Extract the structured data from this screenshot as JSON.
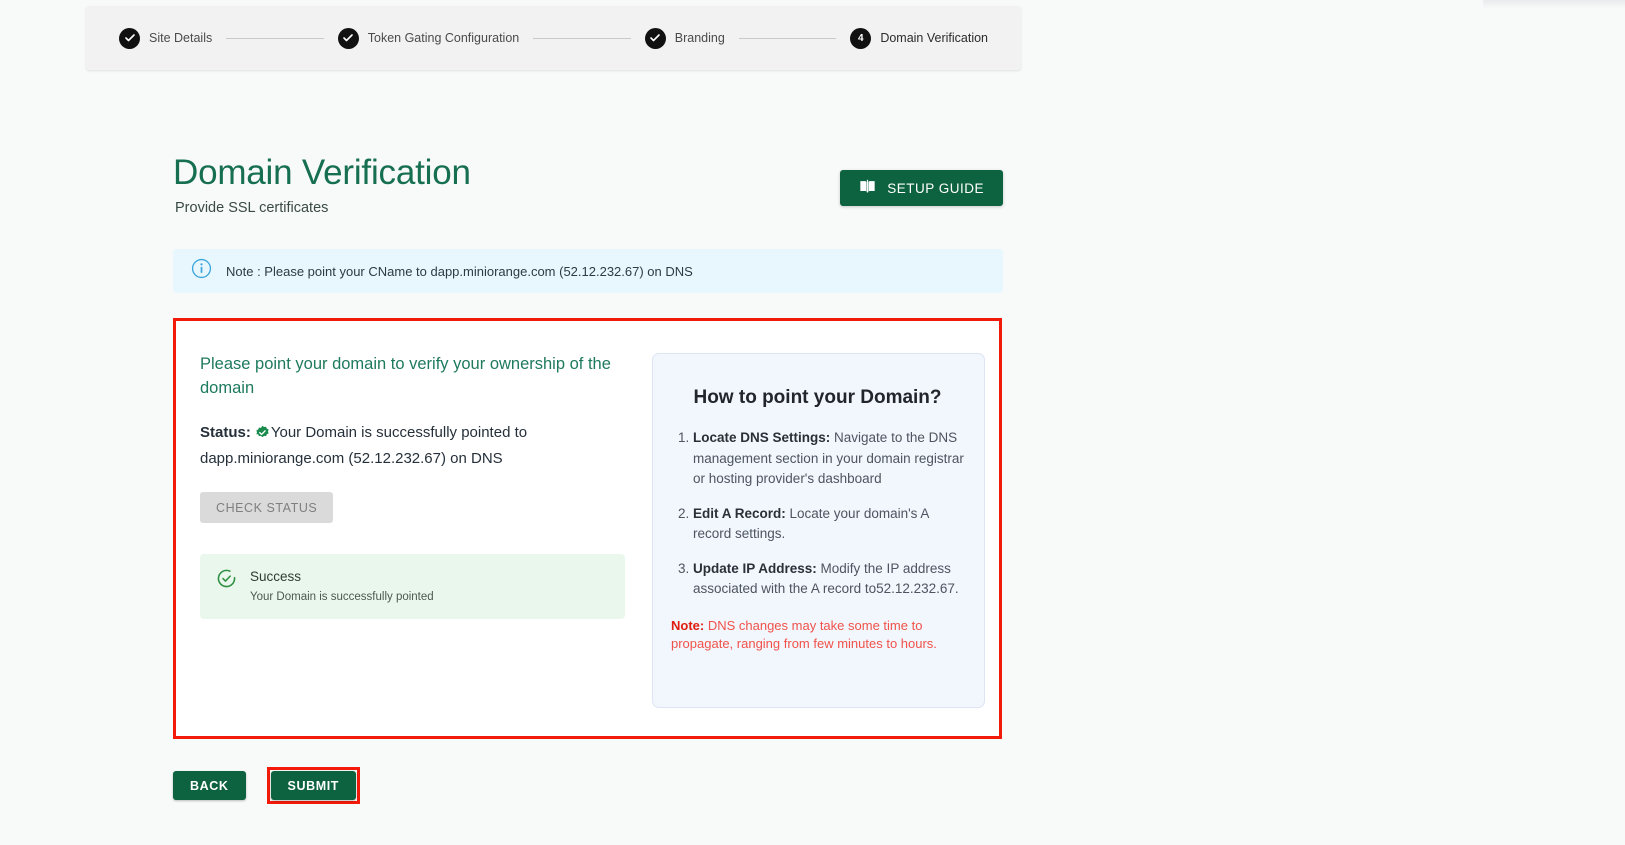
{
  "stepper": {
    "steps": [
      {
        "label": "Site Details",
        "marker": "check",
        "state": "complete"
      },
      {
        "label": "Token Gating Configuration",
        "marker": "check",
        "state": "complete"
      },
      {
        "label": "Branding",
        "marker": "check",
        "state": "complete"
      },
      {
        "label": "Domain Verification",
        "marker": "4",
        "state": "active"
      }
    ]
  },
  "header": {
    "title": "Domain Verification",
    "subtitle": "Provide SSL certificates",
    "setup_guide_label": "SETUP GUIDE"
  },
  "note_bar": {
    "icon": "info-icon",
    "text": "Note : Please point your CName to dapp.miniorange.com (52.12.232.67) on DNS"
  },
  "main": {
    "left": {
      "heading": "Please point your domain to verify your ownership of the domain",
      "status_label": "Status:",
      "status_text": "Your Domain is successfully pointed to dapp.miniorange.com (52.12.232.67) on DNS",
      "status_badge": "verified-badge-icon",
      "check_status_label": "CHECK STATUS",
      "success": {
        "icon": "check-circle-icon",
        "title": "Success",
        "description": "Your Domain is successfully pointed"
      }
    },
    "right": {
      "title": "How to point your Domain?",
      "steps": [
        {
          "term": "Locate DNS Settings:",
          "text": " Navigate to the DNS management section in your domain registrar or hosting provider's dashboard"
        },
        {
          "term": "Edit A Record:",
          "text": " Locate your domain's A record settings."
        },
        {
          "term": "Update IP Address:",
          "text": " Modify the IP address associated with the A record to52.12.232.67."
        }
      ],
      "note_label": "Note:",
      "note_text": " DNS changes may take some time to propagate, ranging from few minutes to hours."
    }
  },
  "footer": {
    "back_label": "BACK",
    "submit_label": "SUBMIT"
  },
  "colors": {
    "brand_green": "#0d6340",
    "title_green": "#176f52",
    "highlight_red": "#f21a09",
    "note_blue_bg": "#e8f6fd",
    "success_bg": "#eaf7ec",
    "panel_bg": "#f2f6fd",
    "page_bg": "#f8faf9"
  }
}
